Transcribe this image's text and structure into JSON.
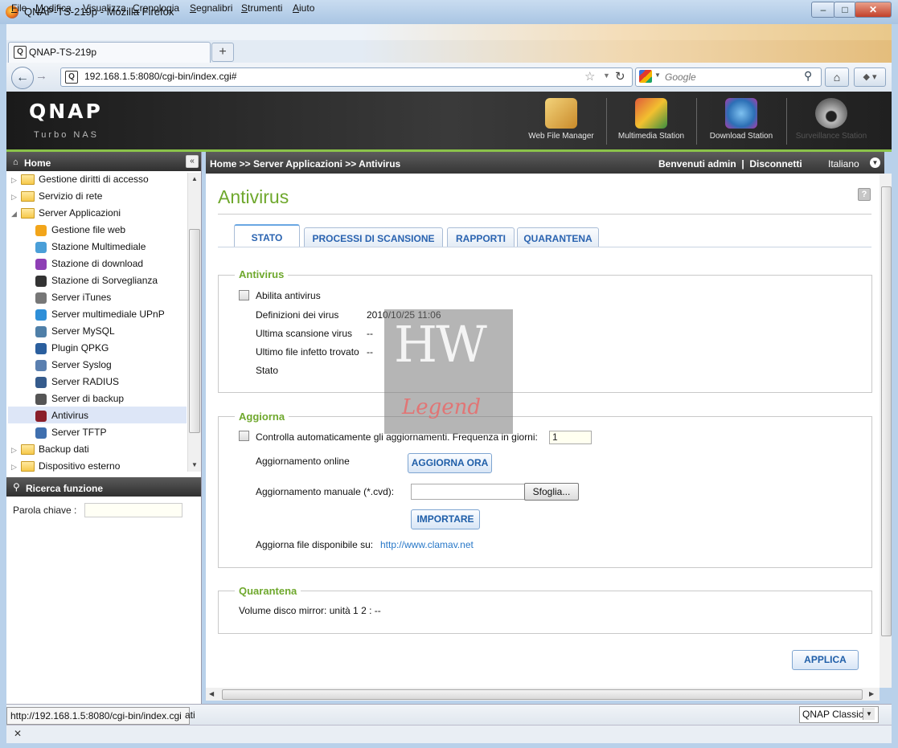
{
  "window": {
    "title": "QNAP-TS-219p - Mozilla Firefox",
    "min": "–",
    "max": "□",
    "close": "✕"
  },
  "menu": [
    "File",
    "Modifica",
    "Visualizza",
    "Cronologia",
    "Segnalibri",
    "Strumenti",
    "Aiuto"
  ],
  "browser": {
    "tab_title": "QNAP-TS-219p",
    "new_tab": "+",
    "url": "192.168.1.5:8080/cgi-bin/index.cgi#",
    "search_placeholder": "Google"
  },
  "qnap": {
    "logo": "QNAP",
    "subtitle": "Turbo NAS",
    "apps": [
      {
        "label": "Web File Manager",
        "icon": "web-file-manager-icon"
      },
      {
        "label": "Multimedia Station",
        "icon": "multimedia-station-icon"
      },
      {
        "label": "Download Station",
        "icon": "download-station-icon"
      },
      {
        "label": "Surveillance Station",
        "icon": "surveillance-station-icon"
      }
    ]
  },
  "sidebar": {
    "home": "Home",
    "items": [
      {
        "label": "Gestione diritti di accesso",
        "type": "folder",
        "arrow": "▷"
      },
      {
        "label": "Servizio di rete",
        "type": "folder",
        "arrow": "▷"
      },
      {
        "label": "Server Applicazioni",
        "type": "folder",
        "arrow": "◢"
      },
      {
        "label": "Gestione file web",
        "type": "child",
        "color": "#f2a51a"
      },
      {
        "label": "Stazione Multimediale",
        "type": "child",
        "color": "#4a9fd8"
      },
      {
        "label": "Stazione di download",
        "type": "child",
        "color": "#8e3fb5"
      },
      {
        "label": "Stazione di Sorveglianza",
        "type": "child",
        "color": "#333333"
      },
      {
        "label": "Server iTunes",
        "type": "child",
        "color": "#777777"
      },
      {
        "label": "Server multimediale UPnP",
        "type": "child",
        "color": "#2e8fd8"
      },
      {
        "label": "Server MySQL",
        "type": "child",
        "color": "#4f7fa8"
      },
      {
        "label": "Plugin QPKG",
        "type": "child",
        "color": "#2b5f9e"
      },
      {
        "label": "Server Syslog",
        "type": "child",
        "color": "#5a7fb0"
      },
      {
        "label": "Server RADIUS",
        "type": "child",
        "color": "#355b8c"
      },
      {
        "label": "Server di backup",
        "type": "child",
        "color": "#555555"
      },
      {
        "label": "Antivirus",
        "type": "child",
        "color": "#8a1f2a"
      },
      {
        "label": "Server TFTP",
        "type": "child",
        "color": "#3f6fae"
      },
      {
        "label": "Backup dati",
        "type": "folder",
        "arrow": "▷"
      },
      {
        "label": "Dispositivo esterno",
        "type": "folder",
        "arrow": "▷"
      }
    ],
    "search_title": "Ricerca funzione",
    "keyword_label": "Parola chiave :"
  },
  "header": {
    "breadcrumb": "Home >> Server Applicazioni >> Antivirus",
    "welcome": "Benvenuti admin  |  Disconnetti",
    "language": "Italiano"
  },
  "page": {
    "title": "Antivirus",
    "help": "?",
    "tabs": [
      "STATO",
      "PROCESSI DI SCANSIONE",
      "RAPPORTI",
      "QUARANTENA"
    ],
    "antivirus": {
      "legend": "Antivirus",
      "enable_label": "Abilita antivirus",
      "enabled": false,
      "rows": [
        {
          "label": "Definizioni dei virus",
          "value": "2010/10/25 11:06"
        },
        {
          "label": "Ultima scansione virus",
          "value": "--"
        },
        {
          "label": "Ultimo file infetto trovato",
          "value": "--"
        },
        {
          "label": "Stato",
          "value": ""
        }
      ]
    },
    "update": {
      "legend": "Aggiorna",
      "auto_label": "Controlla automaticamente gli aggiornamenti. Frequenza in giorni:",
      "auto_checked": false,
      "frequency": "1",
      "online_label": "Aggiornamento online",
      "online_button": "AGGIORNA ORA",
      "manual_label": "Aggiornamento manuale (*.cvd):",
      "browse_button": "Sfoglia...",
      "import_button": "IMPORTARE",
      "available_label": "Aggiorna file disponibile su:",
      "available_link": "http://www.clamav.net"
    },
    "quarantine": {
      "legend": "Quarantena",
      "text": "Volume disco mirror: unità 1 2 : --"
    },
    "apply_button": "APPLICA"
  },
  "watermark": {
    "line1": "HW",
    "line2": "Legend"
  },
  "statusbar": {
    "url_tip": "http://192.168.1.5:8080/cgi-bin/index.cgi",
    "rest": "ati",
    "style_select": "QNAP Classic",
    "find_close": "✕"
  }
}
